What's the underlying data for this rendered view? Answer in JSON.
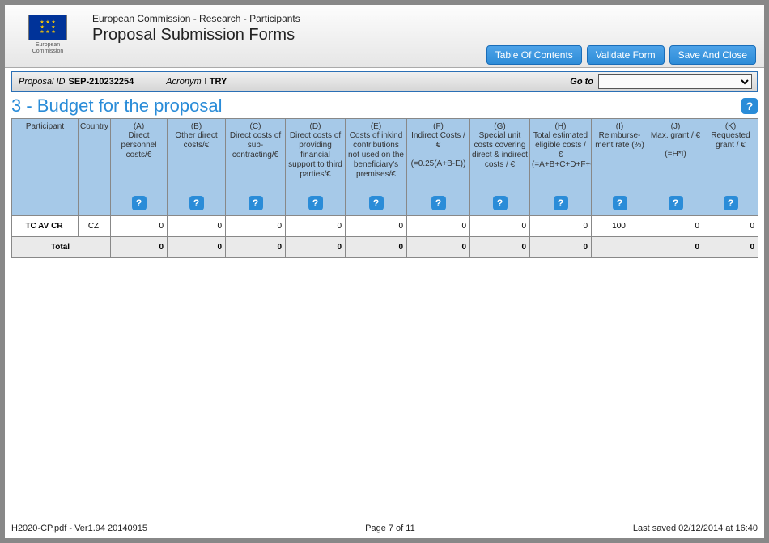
{
  "header": {
    "org_line": "European Commission - Research - Participants",
    "title": "Proposal Submission Forms",
    "ec_label_1": "European",
    "ec_label_2": "Commission",
    "buttons": {
      "toc": "Table Of Contents",
      "validate": "Validate Form",
      "save": "Save And Close"
    }
  },
  "infobar": {
    "proposal_id_label": "Proposal ID",
    "proposal_id": "SEP-210232254",
    "acronym_label": "Acronym",
    "acronym": "I TRY",
    "goto_label": "Go to"
  },
  "section": {
    "title": "3 - Budget for the proposal"
  },
  "columns": {
    "participant": "Participant",
    "country": "Country",
    "A": {
      "letter": "(A)",
      "text": "Direct personnel costs/€"
    },
    "B": {
      "letter": "(B)",
      "text": "Other direct costs/€"
    },
    "C": {
      "letter": "(C)",
      "text": "Direct costs of sub-contracting/€"
    },
    "D": {
      "letter": "(D)",
      "text": "Direct costs of providing financial support to third parties/€"
    },
    "E": {
      "letter": "(E)",
      "text": "Costs of inkind contributions not used on the beneficiary's premises/€"
    },
    "F": {
      "letter": "(F)",
      "text": "Indirect Costs / €",
      "formula": "(=0.25(A+B-E))"
    },
    "G": {
      "letter": "(G)",
      "text": "Special unit costs covering direct & indirect costs / €"
    },
    "H": {
      "letter": "(H)",
      "text": "Total estimated eligible costs / €",
      "formula": "(=A+B+C+D+F+G)"
    },
    "I": {
      "letter": "(I)",
      "text": "Reimburse-ment rate (%)"
    },
    "J": {
      "letter": "(J)",
      "text": "Max. grant / €",
      "formula": "(=H*I)"
    },
    "K": {
      "letter": "(K)",
      "text": "Requested grant / €"
    }
  },
  "rows": [
    {
      "participant": "TC AV CR",
      "country": "CZ",
      "A": "0",
      "B": "0",
      "C": "0",
      "D": "0",
      "E": "0",
      "F": "0",
      "G": "0",
      "H": "0",
      "I": "100",
      "J": "0",
      "K": "0"
    }
  ],
  "total": {
    "label": "Total",
    "A": "0",
    "B": "0",
    "C": "0",
    "D": "0",
    "E": "0",
    "F": "0",
    "G": "0",
    "H": "0",
    "J": "0",
    "K": "0"
  },
  "footer": {
    "left": "H2020-CP.pdf - Ver1.94 20140915",
    "center": "Page 7 of 11",
    "right": "Last saved   02/12/2014  at 16:40"
  }
}
